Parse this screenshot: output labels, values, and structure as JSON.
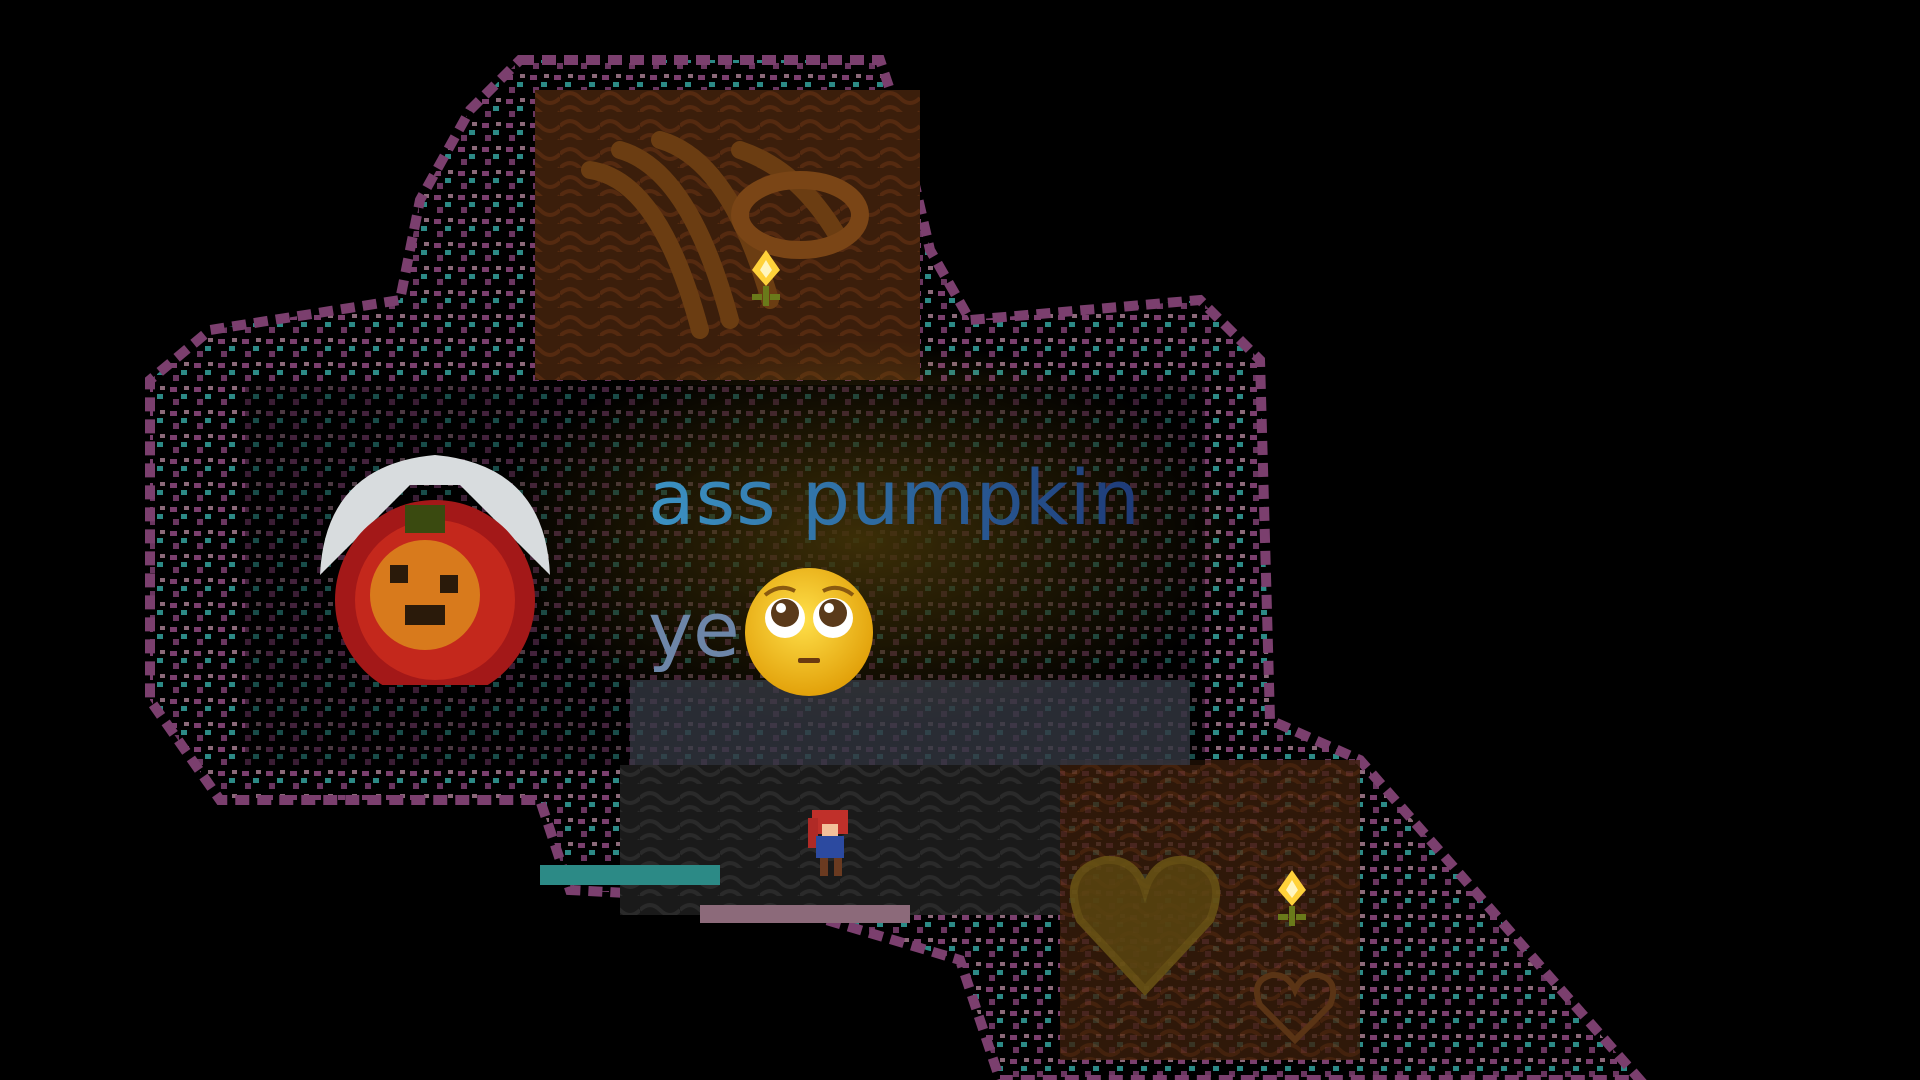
{
  "game": {
    "dialog": {
      "line1": "ass pumpkin",
      "line2": "ye",
      "emoji": "pleading-face-emoji"
    },
    "portrait": "pumpkin-character-portrait",
    "player": "red-haired-climber-sprite",
    "collectibles": [
      "golden-strawberry-flower",
      "golden-strawberry-flower"
    ],
    "decor": [
      "heart-gem-outline",
      "heart-gem-outline"
    ]
  },
  "colors": {
    "background": "#000000",
    "rock_purple": "#7b3f6e",
    "rock_teal": "#2c8a86",
    "wall_brown": "#4a2710",
    "text_blue_start": "#3c93c3",
    "text_blue_end": "#1e3a78",
    "light_glow": "#6a5410"
  }
}
